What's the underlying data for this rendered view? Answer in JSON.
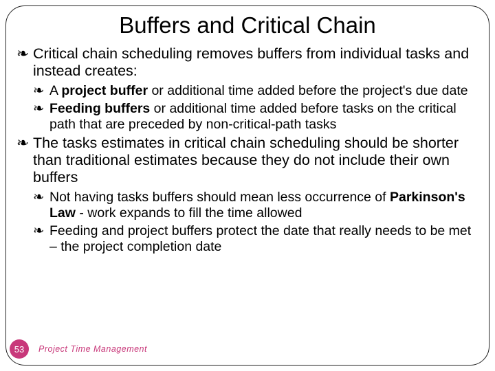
{
  "title": "Buffers and Critical Chain",
  "bullets": {
    "b1": "Critical chain scheduling removes buffers from individual tasks and instead creates:",
    "b1a_pre": "A ",
    "b1a_bold": "project buffer",
    "b1a_post": " or additional time added before the project's due date",
    "b1b_bold": "Feeding buffers",
    "b1b_post": " or additional time added before tasks on the critical path that are preceded by non-critical-path tasks",
    "b2": "The tasks estimates in critical chain scheduling should be shorter than traditional estimates because they do not include their own buffers",
    "b2a_pre": "Not having tasks buffers should mean less occurrence of ",
    "b2a_bold": "Parkinson's Law",
    "b2a_post": " - work expands to fill the time allowed",
    "b2b": "Feeding and project buffers protect the date that really needs to be met – the project completion date"
  },
  "page_number": "53",
  "footer": "Project Time Management"
}
